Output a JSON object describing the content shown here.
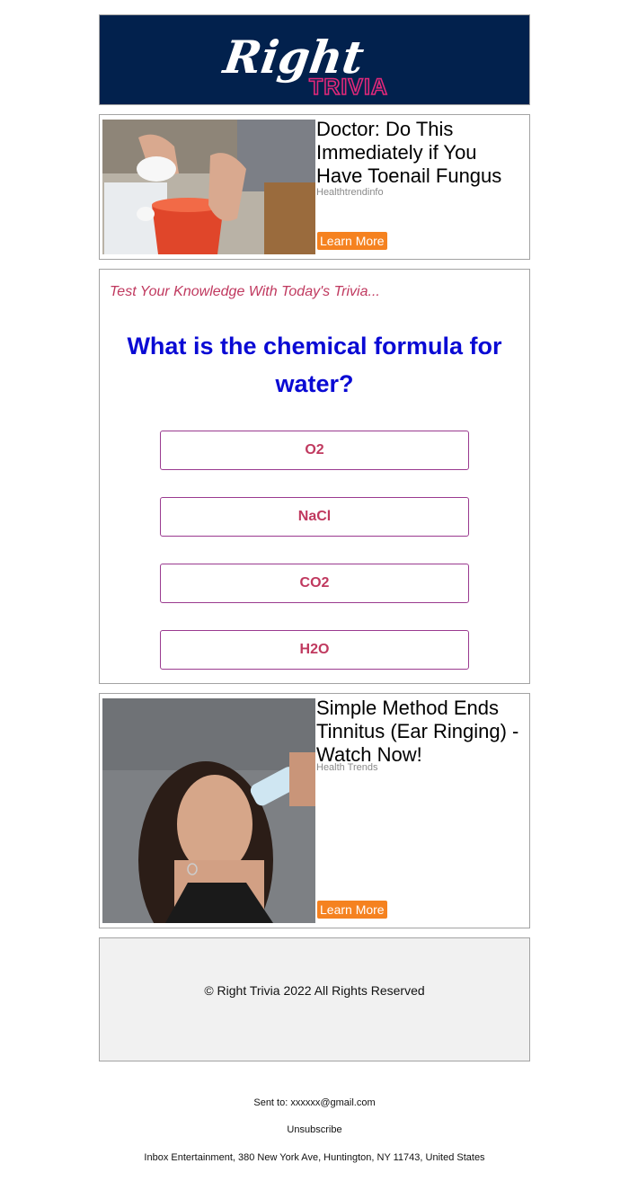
{
  "header": {
    "logo_word": "Right",
    "logo_sub": "TRIVIA",
    "bg_color": "#02214d",
    "accent_color": "#e0287a"
  },
  "ads": [
    {
      "title": "Doctor: Do This Immediately if You Have Toenail Fungus",
      "source": "Healthtrendinfo",
      "cta": "Learn More",
      "image": "foot-soak-bucket-photo"
    },
    {
      "title": "Simple Method Ends Tinnitus (Ear Ringing) - Watch Now!",
      "source": "Health Trends",
      "cta": "Learn More",
      "image": "woman-water-bottle-ear-photo"
    }
  ],
  "trivia": {
    "kicker": "Test Your Knowledge With Today's Trivia...",
    "question": "What is the chemical formula for water?",
    "answers": [
      "O2",
      "NaCl",
      "CO2",
      "H2O"
    ]
  },
  "footer": {
    "copyright": "© Right Trivia 2022 All Rights Reserved",
    "sent_to": "Sent to: xxxxxx@gmail.com",
    "unsubscribe": "Unsubscribe",
    "address": "Inbox Entertainment, 380 New York Ave, Huntington, NY 11743, United States"
  },
  "colors": {
    "cta": "#f58220",
    "question": "#0a0ad4",
    "answer_text": "#c0395f",
    "answer_border": "#9a3a8f"
  }
}
